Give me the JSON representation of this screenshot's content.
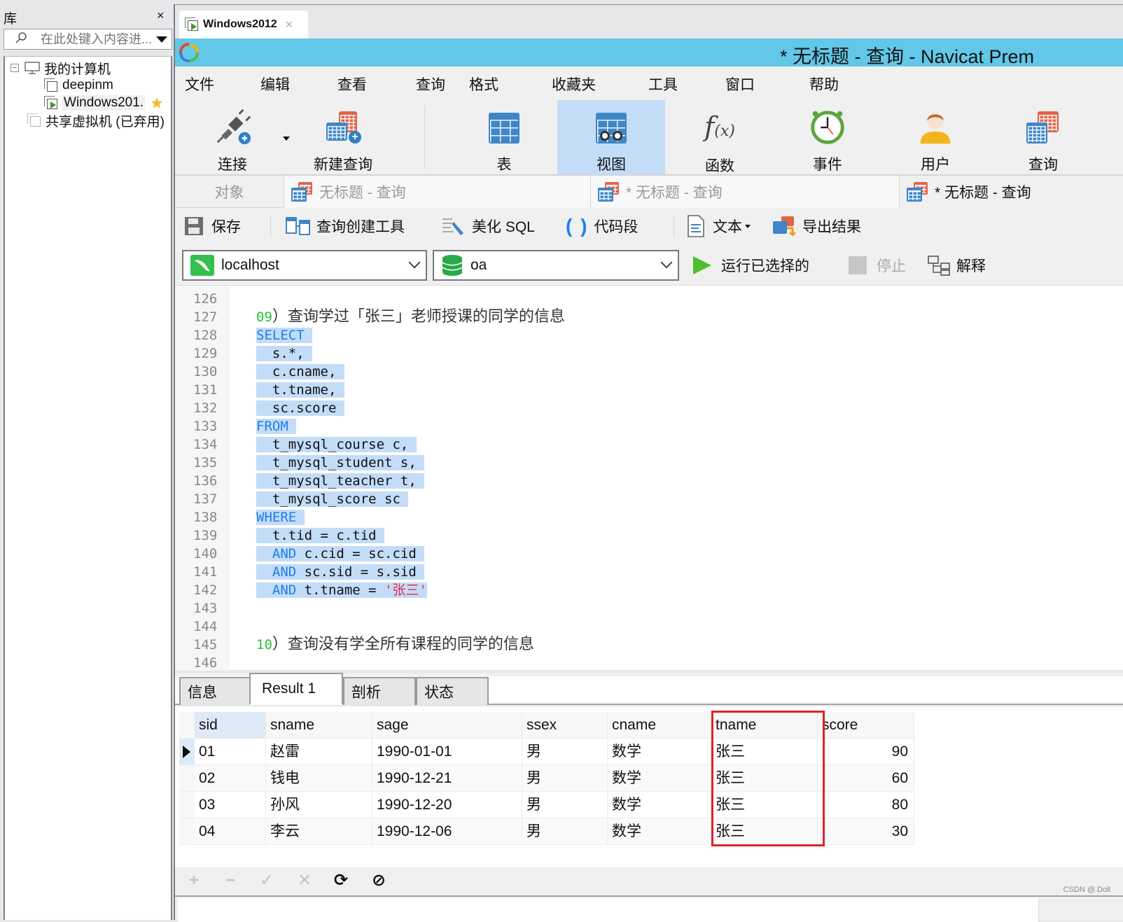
{
  "library": {
    "title": "库",
    "close": "×",
    "search_placeholder": "在此处键入内容进...",
    "tree": [
      {
        "label": "我的计算机",
        "expander": "−"
      },
      {
        "label": "deepinm"
      },
      {
        "label": "Windows201.",
        "favorite": true
      },
      {
        "label": "共享虚拟机 (已弃用)"
      }
    ]
  },
  "vm_tab": {
    "label": "Windows2012",
    "close": "×"
  },
  "window": {
    "title": "* 无标题 - 查询 - Navicat Prem"
  },
  "menu": [
    "文件",
    "编辑",
    "查看",
    "查询",
    "格式",
    "收藏夹",
    "工具",
    "窗口",
    "帮助"
  ],
  "ribbon": {
    "connect": "连接",
    "new_query": "新建查询",
    "table": "表",
    "view": "视图",
    "function": "函数",
    "event": "事件",
    "user": "用户",
    "query": "查询",
    "active": "视图"
  },
  "doc_tabs": {
    "objects": "对象",
    "tabs": [
      "无标题 - 查询",
      "* 无标题 - 查询",
      "* 无标题 - 查询"
    ],
    "active_index": 2
  },
  "query_toolbar": {
    "save": "保存",
    "query_builder": "查询创建工具",
    "beautify": "美化 SQL",
    "snippet": "代码段",
    "text": "文本",
    "export": "导出结果"
  },
  "connection": {
    "server": "localhost",
    "database": "oa",
    "run_selected": "运行已选择的",
    "stop": "停止",
    "explain": "解释"
  },
  "editor": {
    "lines": [
      {
        "n": "126",
        "parts": []
      },
      {
        "n": "127",
        "parts": [
          {
            "t": "09",
            "c": "num"
          },
          {
            "t": "）查询学过「张三」老师授课的同学的信息",
            "c": "cmt"
          }
        ]
      },
      {
        "n": "128",
        "sel": true,
        "parts": [
          {
            "t": "SELECT",
            "c": "kw"
          },
          {
            "t": " "
          }
        ]
      },
      {
        "n": "129",
        "sel": true,
        "parts": [
          {
            "t": "  s.*, "
          }
        ]
      },
      {
        "n": "130",
        "sel": true,
        "parts": [
          {
            "t": "  c.cname, "
          }
        ]
      },
      {
        "n": "131",
        "sel": true,
        "parts": [
          {
            "t": "  t.tname, "
          }
        ]
      },
      {
        "n": "132",
        "sel": true,
        "parts": [
          {
            "t": "  sc.score "
          }
        ]
      },
      {
        "n": "133",
        "sel": true,
        "parts": [
          {
            "t": "FROM",
            "c": "kw"
          },
          {
            "t": " "
          }
        ]
      },
      {
        "n": "134",
        "sel": true,
        "parts": [
          {
            "t": "  t_mysql_course c, "
          }
        ]
      },
      {
        "n": "135",
        "sel": true,
        "parts": [
          {
            "t": "  t_mysql_student s, "
          }
        ]
      },
      {
        "n": "136",
        "sel": true,
        "parts": [
          {
            "t": "  t_mysql_teacher t, "
          }
        ]
      },
      {
        "n": "137",
        "sel": true,
        "parts": [
          {
            "t": "  t_mysql_score sc "
          }
        ]
      },
      {
        "n": "138",
        "sel": true,
        "parts": [
          {
            "t": "WHERE",
            "c": "kw"
          },
          {
            "t": " "
          }
        ]
      },
      {
        "n": "139",
        "sel": true,
        "parts": [
          {
            "t": "  t.tid = c.tid "
          }
        ]
      },
      {
        "n": "140",
        "sel": true,
        "parts": [
          {
            "t": "  "
          },
          {
            "t": "AND",
            "c": "kw"
          },
          {
            "t": " c.cid = sc.cid "
          }
        ]
      },
      {
        "n": "141",
        "sel": true,
        "parts": [
          {
            "t": "  "
          },
          {
            "t": "AND",
            "c": "kw"
          },
          {
            "t": " sc.sid = s.sid "
          }
        ]
      },
      {
        "n": "142",
        "sel": true,
        "parts": [
          {
            "t": "  "
          },
          {
            "t": "AND",
            "c": "kw"
          },
          {
            "t": " t.tname = "
          },
          {
            "t": "'张三'",
            "c": "str"
          }
        ]
      },
      {
        "n": "143",
        "parts": []
      },
      {
        "n": "144",
        "parts": []
      },
      {
        "n": "145",
        "parts": [
          {
            "t": "10",
            "c": "num"
          },
          {
            "t": "）查询没有学全所有课程的同学的信息",
            "c": "cmt"
          }
        ]
      },
      {
        "n": "146",
        "parts": []
      }
    ]
  },
  "result_tabs": [
    "信息",
    "Result 1",
    "剖析",
    "状态"
  ],
  "result_active": "Result 1",
  "grid": {
    "columns": [
      "sid",
      "sname",
      "sage",
      "ssex",
      "cname",
      "tname",
      "score"
    ],
    "rows": [
      [
        "01",
        "赵雷",
        "1990-01-01",
        "男",
        "数学",
        "张三",
        "90"
      ],
      [
        "02",
        "钱电",
        "1990-12-21",
        "男",
        "数学",
        "张三",
        "60"
      ],
      [
        "03",
        "孙风",
        "1990-12-20",
        "男",
        "数学",
        "张三",
        "80"
      ],
      [
        "04",
        "李云",
        "1990-12-06",
        "男",
        "数学",
        "张三",
        "30"
      ]
    ],
    "current_row": 0,
    "highlighted_column": "tname"
  },
  "grid_toolbar": {
    "add": "+",
    "delete": "−",
    "apply": "✓",
    "discard": "✕",
    "refresh": "⟳",
    "stop": "⊘"
  },
  "watermark": "CSDN @.Doll",
  "colors": {
    "titlebar": "#62c7e8",
    "selection": "#c3dcf7",
    "keyword": "#1e7ef0",
    "string": "#e8284a",
    "highlight_box": "#e0222a"
  }
}
